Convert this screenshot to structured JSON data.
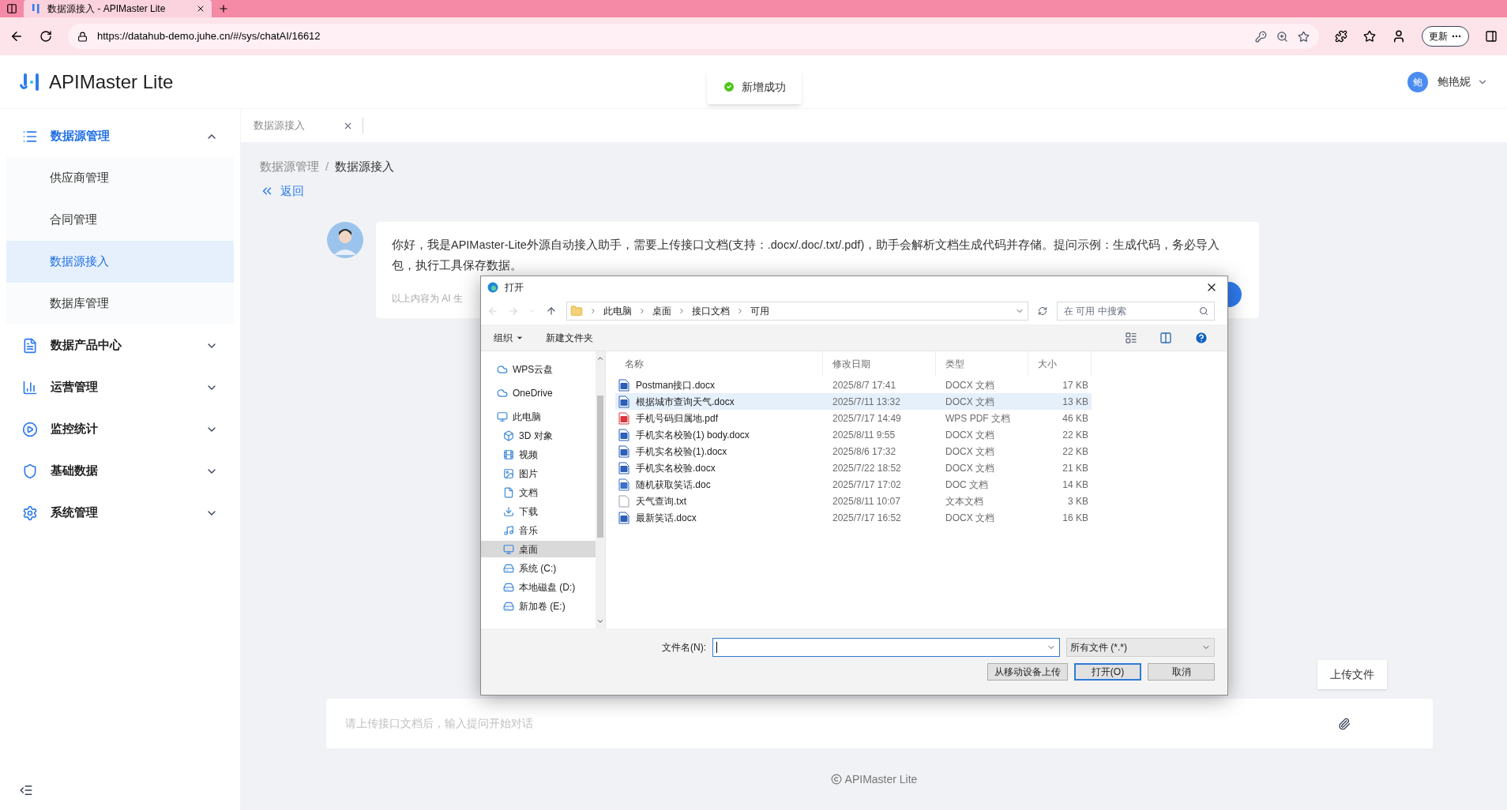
{
  "browser": {
    "tab_title": "数据源接入 - APIMaster Lite",
    "url": "https://datahub-demo.juhe.cn/#/sys/chatAI/16612",
    "update_button": "更新"
  },
  "header": {
    "logo_text": "APIMaster Lite",
    "user_name": "鲍艳妮",
    "avatar_text": "鲍"
  },
  "toast": {
    "text": "新增成功"
  },
  "sidebar": {
    "groups": [
      {
        "label": "数据源管理",
        "expanded": true,
        "children": [
          {
            "label": "供应商管理",
            "selected": false
          },
          {
            "label": "合同管理",
            "selected": false
          },
          {
            "label": "数据源接入",
            "selected": true
          },
          {
            "label": "数据库管理",
            "selected": false
          }
        ]
      },
      {
        "label": "数据产品中心",
        "expanded": false
      },
      {
        "label": "运营管理",
        "expanded": false
      },
      {
        "label": "监控统计",
        "expanded": false
      },
      {
        "label": "基础数据",
        "expanded": false
      },
      {
        "label": "系统管理",
        "expanded": false
      }
    ]
  },
  "page_tabs": [
    {
      "label": "数据源接入",
      "selected": true
    }
  ],
  "breadcrumb": {
    "items": [
      "数据源管理",
      "数据源接入"
    ],
    "separator": "/"
  },
  "back_link": "返回",
  "message": {
    "text": "你好，我是APIMaster-Lite外源自动接入助手，需要上传接口文档(支持：.docx/.doc/.txt/.pdf)，助手会解析文档生成代码并存储。提问示例：生成代码，务必导入包，执行工具保存数据。",
    "note": "以上内容为 AI 生"
  },
  "chat_input": {
    "placeholder": "请上传接口文档后，输入提问开始对话"
  },
  "upload_tooltip": "上传文件",
  "footer": "APIMaster Lite",
  "file_dialog": {
    "title": "打开",
    "path": [
      "此电脑",
      "桌面",
      "接口文档",
      "可用"
    ],
    "search_placeholder": "在 可用 中搜索",
    "organize": "组织",
    "new_folder": "新建文件夹",
    "nav": [
      {
        "label": "WPS云盘",
        "selected": false
      },
      {
        "label": "OneDrive",
        "selected": false
      },
      {
        "label": "此电脑",
        "selected": false,
        "children": [
          {
            "label": "3D 对象",
            "selected": false
          },
          {
            "label": "视频",
            "selected": false
          },
          {
            "label": "图片",
            "selected": false
          },
          {
            "label": "文档",
            "selected": false
          },
          {
            "label": "下载",
            "selected": false
          },
          {
            "label": "音乐",
            "selected": false
          },
          {
            "label": "桌面",
            "selected": true
          },
          {
            "label": "系统 (C:)",
            "selected": false
          },
          {
            "label": "本地磁盘 (D:)",
            "selected": false
          },
          {
            "label": "新加卷 (E:)",
            "selected": false
          }
        ]
      }
    ],
    "columns": [
      "名称",
      "修改日期",
      "类型",
      "大小"
    ],
    "files": [
      {
        "name": "Postman接口.docx",
        "date": "2025/8/7 17:41",
        "type": "DOCX 文档",
        "size": "17 KB",
        "kind": "word",
        "selected": false
      },
      {
        "name": "根据城市查询天气.docx",
        "date": "2025/7/11 13:32",
        "type": "DOCX 文档",
        "size": "13 KB",
        "kind": "word",
        "selected": true
      },
      {
        "name": "手机号码归属地.pdf",
        "date": "2025/7/17 14:49",
        "type": "WPS PDF 文档",
        "size": "46 KB",
        "kind": "pdf",
        "selected": false
      },
      {
        "name": "手机实名校验(1) body.docx",
        "date": "2025/8/11 9:55",
        "type": "DOCX 文档",
        "size": "22 KB",
        "kind": "word",
        "selected": false
      },
      {
        "name": "手机实名校验(1).docx",
        "date": "2025/8/6 17:32",
        "type": "DOCX 文档",
        "size": "22 KB",
        "kind": "word",
        "selected": false
      },
      {
        "name": "手机实名校验.docx",
        "date": "2025/7/22 18:52",
        "type": "DOCX 文档",
        "size": "21 KB",
        "kind": "word",
        "selected": false
      },
      {
        "name": "随机获取笑话.doc",
        "date": "2025/7/17 17:02",
        "type": "DOC 文档",
        "size": "14 KB",
        "kind": "doc",
        "selected": false
      },
      {
        "name": "天气查询.txt",
        "date": "2025/8/11 10:07",
        "type": "文本文档",
        "size": "3 KB",
        "kind": "txt",
        "selected": false
      },
      {
        "name": "最新笑话.docx",
        "date": "2025/7/17 16:52",
        "type": "DOCX 文档",
        "size": "16 KB",
        "kind": "word",
        "selected": false
      }
    ],
    "filename_label": "文件名(N):",
    "filter": "所有文件 (*.*)",
    "buttons": [
      {
        "label": "从移动设备上传",
        "kind": "normal"
      },
      {
        "label": "打开(O)",
        "kind": "default"
      },
      {
        "label": "取消",
        "kind": "normal"
      }
    ]
  }
}
